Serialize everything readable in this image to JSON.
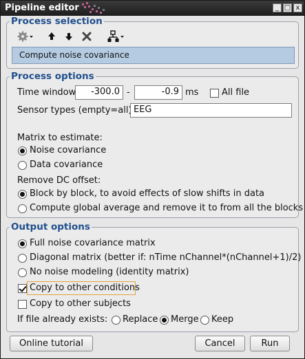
{
  "window": {
    "title": "Pipeline editor",
    "min": "_",
    "max": "□",
    "close": "x"
  },
  "process_selection": {
    "legend": "Process selection",
    "selected_process": "Compute noise covariance"
  },
  "process_options": {
    "legend": "Process options",
    "time_window_label": "Time window:",
    "time_start": "-300.0",
    "time_sep": "-",
    "time_end": "-0.9",
    "time_unit": "ms",
    "all_file_label": "All file",
    "sensor_types_label": "Sensor types (empty=all):",
    "sensor_types_value": "EEG",
    "matrix_label": "Matrix to estimate:",
    "matrix_options": [
      "Noise covariance",
      "Data covariance"
    ],
    "matrix_selected": 0,
    "dc_label": "Remove DC offset:",
    "dc_options": [
      "Block by block, to avoid effects of slow shifts in data",
      "Compute global average and remove it to from all the blocks"
    ],
    "dc_selected": 0
  },
  "output_options": {
    "legend": "Output options",
    "cov_options": [
      "Full noise covariance matrix",
      "Diagonal matrix (better if: nTime nChannel*(nChannel+1)/2)",
      "No noise modeling (identity matrix)"
    ],
    "cov_selected": 0,
    "copy_conditions_label": "Copy to other conditions",
    "copy_conditions_checked": true,
    "copy_subjects_label": "Copy to other subjects",
    "copy_subjects_checked": false,
    "exists_label": "If file already exists:",
    "exists_options": [
      "Replace",
      "Merge",
      "Keep"
    ],
    "exists_selected": 1
  },
  "buttons": {
    "tutorial": "Online tutorial",
    "cancel": "Cancel",
    "run": "Run"
  },
  "colors": {
    "legend": "#1f4e8c",
    "selection": "#b5cbe2",
    "focus": "#e0a33a"
  }
}
